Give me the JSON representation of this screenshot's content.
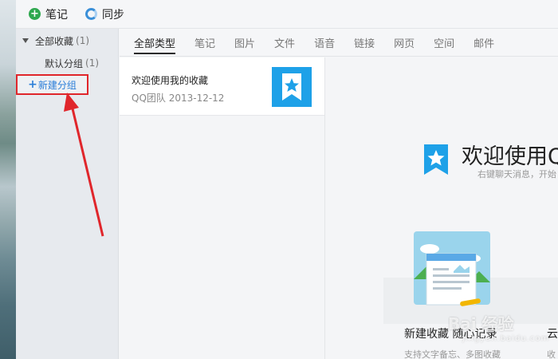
{
  "toolbar": {
    "note_label": "笔记",
    "sync_label": "同步"
  },
  "sidebar": {
    "root_label": "全部收藏",
    "root_count": "(1)",
    "items": [
      {
        "label": "默认分组",
        "count": "(1)"
      }
    ],
    "new_group_label": "新建分组"
  },
  "tabs": [
    "全部类型",
    "笔记",
    "图片",
    "文件",
    "语音",
    "链接",
    "网页",
    "空间",
    "邮件"
  ],
  "list": {
    "items": [
      {
        "title": "欢迎使用我的收藏",
        "meta": "QQ团队 2013-12-12"
      }
    ]
  },
  "detail": {
    "welcome_title": "欢迎使用Q",
    "welcome_sub": "右键聊天消息，开始",
    "feature1_title": "新建收藏 随心记录",
    "feature1_sub": "支持文字备忘、多图收藏",
    "feature2_title": "云",
    "feature2_sub": "收"
  },
  "watermark": {
    "brand": "Bai 经验",
    "url": "jingyan.baidu.com"
  },
  "colors": {
    "accent_blue": "#1ea1e8",
    "highlight_red": "#e0262b",
    "add_green": "#2fa84f",
    "link_blue": "#2b7ed8"
  }
}
